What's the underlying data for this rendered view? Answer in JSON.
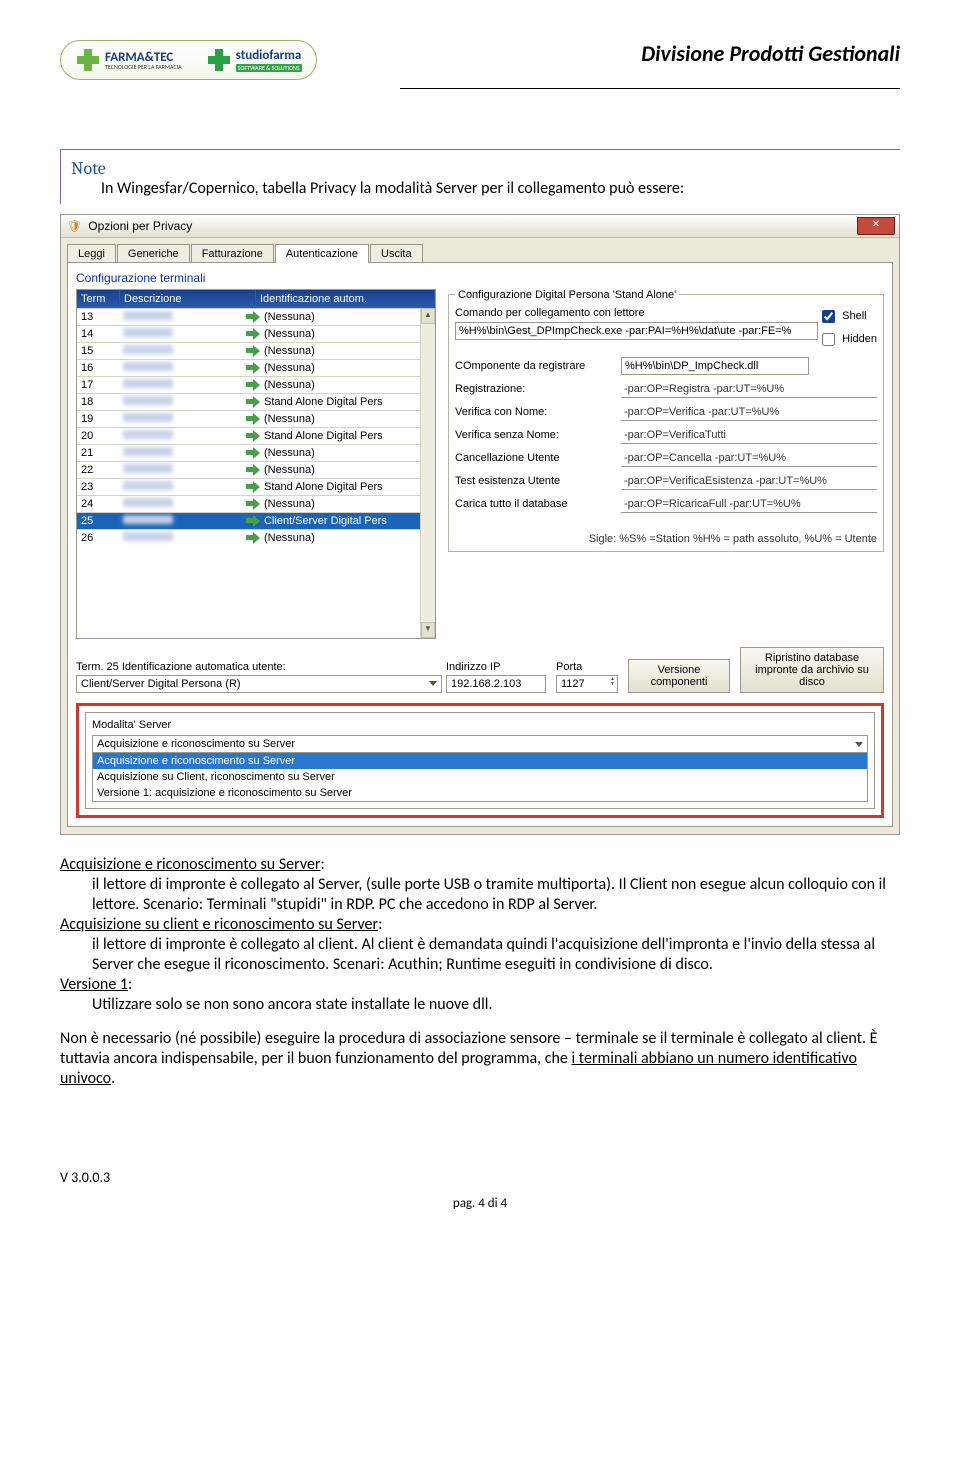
{
  "header": {
    "division": "Divisione Prodotti Gestionali",
    "logo1_main_a": "FARMA",
    "logo1_amp": "&",
    "logo1_main_b": "TEC",
    "logo1_sub": "TECNOLOGIE PER LA FARMACIA",
    "logo2_main": "studiofarma",
    "logo2_sub": "SOFTWARE & SOLUTIONS"
  },
  "note": {
    "title": "Note",
    "intro": "In Wingesfar/Copernico, tabella Privacy la modalità Server per il collegamento può essere:"
  },
  "dialog": {
    "title": "Opzioni per Privacy",
    "tabs": [
      "Leggi",
      "Generiche",
      "Fatturazione",
      "Autenticazione",
      "Uscita"
    ],
    "active_tab": 3,
    "section": "Configurazione terminali",
    "table": {
      "headers": [
        "Term",
        "Descrizione",
        "Identificazione autom."
      ],
      "rows": [
        {
          "term": "13",
          "id": "(Nessuna)"
        },
        {
          "term": "14",
          "id": "(Nessuna)"
        },
        {
          "term": "15",
          "id": "(Nessuna)"
        },
        {
          "term": "16",
          "id": "(Nessuna)"
        },
        {
          "term": "17",
          "id": "(Nessuna)"
        },
        {
          "term": "18",
          "id": "Stand Alone Digital Pers"
        },
        {
          "term": "19",
          "id": "(Nessuna)"
        },
        {
          "term": "20",
          "id": "Stand Alone Digital Pers"
        },
        {
          "term": "21",
          "id": "(Nessuna)"
        },
        {
          "term": "22",
          "id": "(Nessuna)"
        },
        {
          "term": "23",
          "id": "Stand Alone Digital Pers"
        },
        {
          "term": "24",
          "id": "(Nessuna)"
        },
        {
          "term": "25",
          "id": "Client/Server Digital Pers",
          "selected": true
        },
        {
          "term": "26",
          "id": "(Nessuna)"
        }
      ]
    },
    "dp_group": "Configurazione Digital Persona 'Stand Alone'",
    "right": {
      "cmd_label": "Comando per collegamento con lettore",
      "cmd_value": "%H%\\bin\\Gest_DPImpCheck.exe -par:PAI=%H%\\dat\\ute -par:FE=%",
      "shell": "Shell",
      "hidden": "Hidden",
      "componente_label": "COmponente da registrare",
      "componente_value": "%H%\\bin\\DP_ImpCheck.dll",
      "registrazione_label": "Registrazione:",
      "registrazione_value": "-par:OP=Registra -par:UT=%U%",
      "verifica_nome_label": "Verifica con Nome:",
      "verifica_nome_value": "-par:OP=Verifica -par:UT=%U%",
      "verifica_senza_label": "Verifica senza Nome:",
      "verifica_senza_value": "-par:OP=VerificaTutti",
      "cancellazione_label": "Cancellazione Utente",
      "cancellazione_value": "-par:OP=Cancella -par:UT=%U%",
      "test_label": "Test esistenza Utente",
      "test_value": "-par:OP=VerificaEsistenza -par:UT=%U%",
      "carica_label": "Carica tutto il database",
      "carica_value": "-par:OP=RicaricaFull -par:UT=%U%",
      "sigle": "Sigle: %S% =Station %H% = path assoluto, %U% = Utente"
    },
    "bottom": {
      "term_label": "Term. 25 Identificazione automatica utente:",
      "term_value": "Client/Server Digital Persona (R)",
      "ip_label": "Indirizzo IP",
      "ip_value": "192.168.2.103",
      "porta_label": "Porta",
      "porta_value": "1127",
      "btn_versione": "Versione componenti",
      "btn_ripristino": "Ripristino database impronte da archivio su disco"
    },
    "server": {
      "title": "Modalita' Server",
      "selected": "Acquisizione e riconoscimento su Server",
      "options": [
        "Acquisizione e riconoscimento su Server",
        "Acquisizione su Client, riconoscimento su Server",
        "Versione 1: acquisizione e riconoscimento su Server"
      ]
    }
  },
  "body": {
    "srv_h": "Acquisizione e riconoscimento su Server",
    "srv_t1": "il lettore di impronte è collegato al Server, (sulle porte USB o tramite multiporta). Il Client non esegue alcun colloquio con il lettore. Scenario: Terminali \"stupidi\" in RDP. PC che accedono in RDP al Server.",
    "cli_h": "Acquisizione su client e riconoscimento su Server",
    "cli_t1": "il lettore di impronte è collegato al client. Al client è demandata quindi l'acquisizione dell'impronta e l'invio della stessa al Server che esegue il riconoscimento. Scenari: Acuthin; Runtime eseguiti in condivisione di disco.",
    "v1_h": "Versione 1",
    "v1_t": "Utilizzare solo se non sono ancora state installate le nuove dll.",
    "p2a": "Non è necessario (né possibile) eseguire la procedura di associazione sensore – terminale se il terminale è collegato al client. È tuttavia ancora indispensabile, per il buon funzionamento del programma, che ",
    "p2b": "i terminali abbiano un numero identificativo univoco",
    "p2c": "."
  },
  "footer": {
    "version": "V 3.0.0.3",
    "page": "pag. 4 di 4"
  }
}
